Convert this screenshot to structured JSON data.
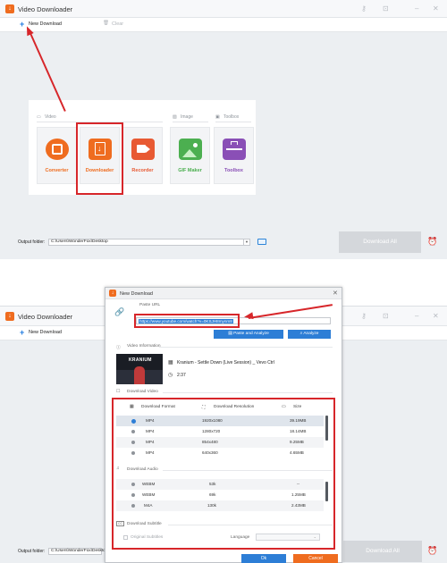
{
  "app": {
    "title": "Video Downloader"
  },
  "toolbar": {
    "new_download": "New Download",
    "clear": "Clear"
  },
  "categories": {
    "video": "Video",
    "image": "Image",
    "toolbox": "Toolbox"
  },
  "tiles": [
    {
      "label": "Converter",
      "color": "#ef6c1f"
    },
    {
      "label": "Downloader",
      "color": "#ef6c1f"
    },
    {
      "label": "Recorder",
      "color": "#e85a33"
    },
    {
      "label": "GIF Maker",
      "color": "#4caf50"
    },
    {
      "label": "Toolbox",
      "color": "#8a4fb6"
    }
  ],
  "output": {
    "label": "Output folder:",
    "path": "C:\\Users\\WonderFox\\Desktop",
    "download_all": "Download All"
  },
  "dialog": {
    "title": "New Download",
    "paste_label": "Paste URL",
    "url": "https://www.youtube.com/watch?v=0KSJH8mynm8",
    "paste_analyze": "Paste and Analyze",
    "analyze": "Analyze",
    "video_info_label": "Video Information",
    "video_title": "Kranium - Settle Down (Live Session) _ Vevo Ctrl",
    "duration": "2:37",
    "thumb_text": "KRANIUM",
    "download_video_label": "Download Video",
    "col_format": "Download Format",
    "col_resolution": "Download Resolution",
    "col_size": "Size",
    "video_rows": [
      {
        "format": "MP4",
        "resolution": "1920x1080",
        "size": "39.19MB"
      },
      {
        "format": "MP4",
        "resolution": "1280x720",
        "size": "18.14MB"
      },
      {
        "format": "MP4",
        "resolution": "854x480",
        "size": "9.25MB"
      },
      {
        "format": "MP4",
        "resolution": "640x360",
        "size": "4.65MB"
      }
    ],
    "download_audio_label": "Download Audio",
    "audio_rows": [
      {
        "format": "WEBM",
        "bitrate": "53k",
        "size": "--"
      },
      {
        "format": "WEBM",
        "bitrate": "69k",
        "size": "1.25MB"
      },
      {
        "format": "M4A",
        "bitrate": "130k",
        "size": "2.43MB"
      }
    ],
    "download_subtitle_label": "Download Subtitle",
    "original_subtitles": "Original Subtitles",
    "language_label": "Language",
    "ok": "Ok",
    "cancel": "Cancel"
  },
  "colors": {
    "accent": "#2d7ed6",
    "highlight": "#d7262a",
    "brand": "#ef6c1f"
  }
}
